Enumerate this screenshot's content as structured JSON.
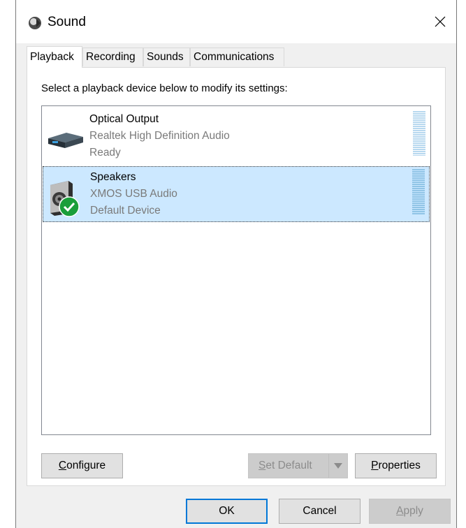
{
  "window": {
    "title": "Sound",
    "close_glyph": "✕"
  },
  "tabs": [
    {
      "label": "Playback",
      "active": true
    },
    {
      "label": "Recording",
      "active": false
    },
    {
      "label": "Sounds",
      "active": false
    },
    {
      "label": "Communications",
      "active": false
    }
  ],
  "playback": {
    "instruction": "Select a playback device below to modify its settings:",
    "devices": [
      {
        "name": "Optical Output",
        "driver": "Realtek High Definition Audio",
        "status": "Ready",
        "icon": "optical-output-icon",
        "selected": false
      },
      {
        "name": "Speakers",
        "driver": "XMOS USB Audio",
        "status": "Default Device",
        "icon": "speaker-icon",
        "badge_icon": "default-device-check-icon",
        "selected": true
      }
    ],
    "buttons": {
      "configure": {
        "prefix": "",
        "mnemonic": "C",
        "rest": "onfigure"
      },
      "set_default": {
        "prefix": "",
        "mnemonic": "S",
        "rest": "et Default",
        "enabled": false
      },
      "properties": {
        "prefix": "",
        "mnemonic": "P",
        "rest": "roperties"
      }
    }
  },
  "footer": {
    "ok": "OK",
    "cancel": "Cancel",
    "apply": {
      "prefix": "",
      "mnemonic": "A",
      "rest": "pply",
      "enabled": false
    }
  },
  "colors": {
    "selection": "#cce8ff",
    "accent": "#0078d7",
    "check_green": "#1a9e3a"
  }
}
